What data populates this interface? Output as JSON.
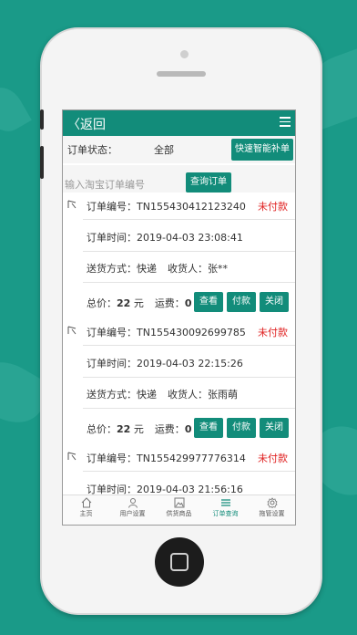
{
  "header": {
    "back_label": "返回"
  },
  "filter": {
    "status_label": "订单状态：",
    "status_value": "全部",
    "quick_button": "快速智能补单"
  },
  "search": {
    "placeholder": "输入淘宝订单编号",
    "query_button": "查询订单"
  },
  "orders": [
    {
      "number_label": "订单编号：",
      "number": "TN155430412123240",
      "status": "未付款",
      "time_label": "订单时间：",
      "time": "2019-04-03 23:08:41",
      "delivery_label": "送货方式：",
      "delivery": "快递",
      "receiver_label": "收货人：",
      "receiver": "张**",
      "total_label": "总价：",
      "total": "22",
      "unit": "元",
      "fee_label": "运费：",
      "fee": "0",
      "actions": [
        "查看",
        "付款",
        "关闭"
      ]
    },
    {
      "number_label": "订单编号：",
      "number": "TN155430092699785",
      "status": "未付款",
      "time_label": "订单时间：",
      "time": "2019-04-03 22:15:26",
      "delivery_label": "送货方式：",
      "delivery": "快递",
      "receiver_label": "收货人：",
      "receiver": "张雨萌",
      "total_label": "总价：",
      "total": "22",
      "unit": "元",
      "fee_label": "运费：",
      "fee": "0",
      "actions": [
        "查看",
        "付款",
        "关闭"
      ]
    },
    {
      "number_label": "订单编号：",
      "number": "TN155429977776314",
      "status": "未付款",
      "time_label": "订单时间：",
      "time": "2019-04-03 21:56:16"
    }
  ],
  "tabs": [
    {
      "label": "主页",
      "icon": "home-icon"
    },
    {
      "label": "用户设置",
      "icon": "user-icon"
    },
    {
      "label": "供货商品",
      "icon": "image-icon"
    },
    {
      "label": "订单查询",
      "icon": "list-icon",
      "active": true
    },
    {
      "label": "拖管设置",
      "icon": "settings-icon"
    }
  ],
  "colors": {
    "accent": "#128c7a",
    "unpaid": "#e02424",
    "background": "#1a9a88"
  }
}
